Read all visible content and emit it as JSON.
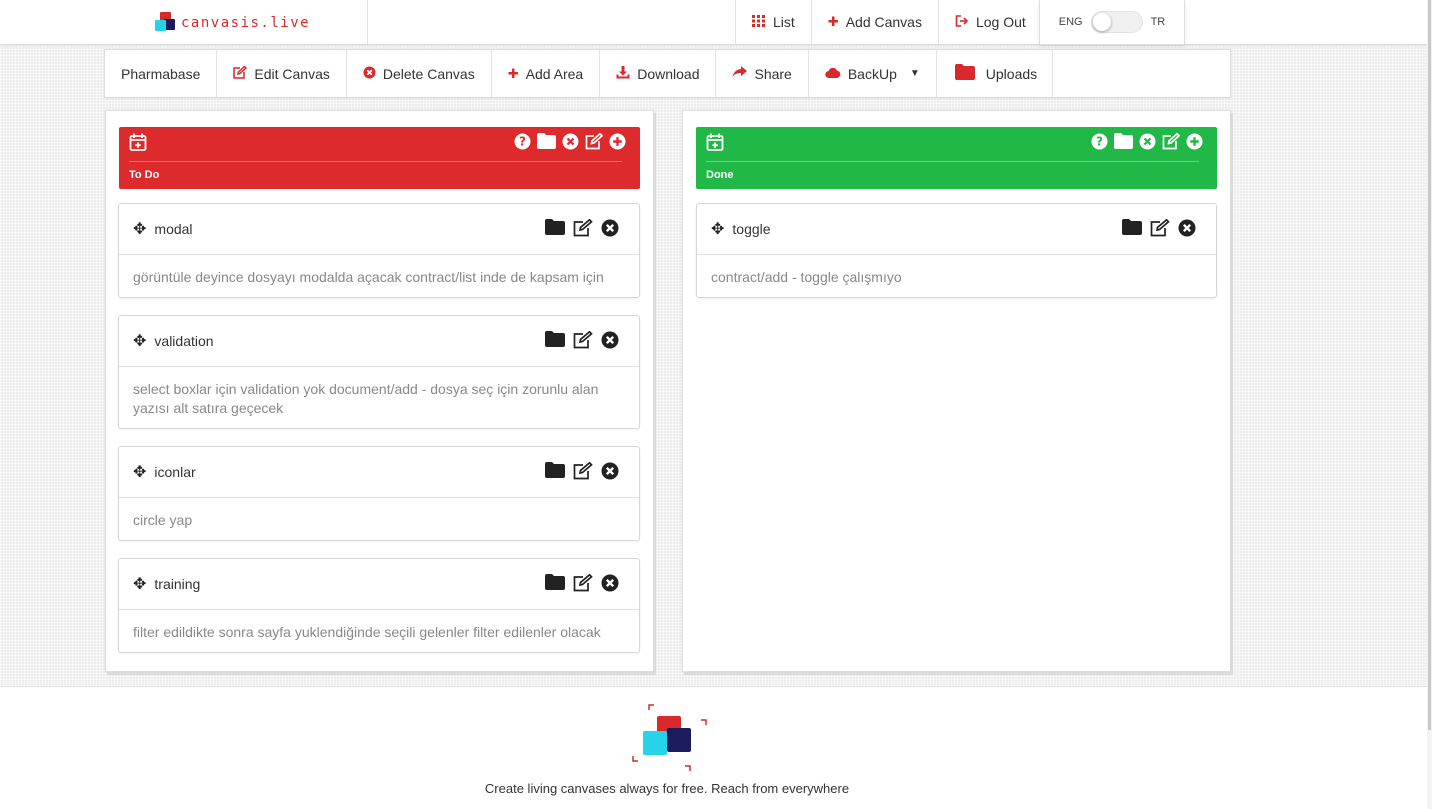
{
  "brand": {
    "name": "canvasis.live",
    "tagline": "Create living canvases always for free. Reach from everywhere"
  },
  "topnav": {
    "items": [
      {
        "icon": "list-icon",
        "label": "List"
      },
      {
        "icon": "plus-icon",
        "label": "Add Canvas"
      },
      {
        "icon": "logout-icon",
        "label": "Log Out"
      }
    ],
    "lang_left": "ENG",
    "lang_right": "TR"
  },
  "toolbar": {
    "canvas_name": "Pharmabase",
    "edit": "Edit Canvas",
    "delete": "Delete Canvas",
    "add_area": "Add Area",
    "download": "Download",
    "share": "Share",
    "backup": "BackUp",
    "uploads": "Uploads"
  },
  "columns": [
    {
      "title": "To Do",
      "color": "#dd2a2c",
      "cards": [
        {
          "name": "modal",
          "desc": "görüntüle deyince dosyayı modalda açacak contract/list inde de kapsam için"
        },
        {
          "name": "validation",
          "desc": "select boxlar için validation yok document/add - dosya seç için zorunlu alan yazısı alt satıra geçecek"
        },
        {
          "name": "iconlar",
          "desc": "circle yap"
        },
        {
          "name": "training",
          "desc": "filter edildikte sonra sayfa yuklendiğinde seçili gelenler filter edilenler olacak"
        }
      ]
    },
    {
      "title": "Done",
      "color": "#22b847",
      "cards": [
        {
          "name": "toggle",
          "desc": "contract/add - toggle çalışmıyo"
        }
      ]
    }
  ]
}
